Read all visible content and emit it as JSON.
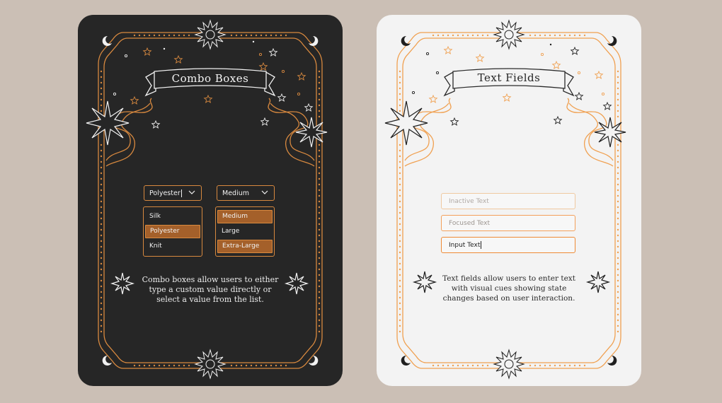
{
  "combo_card": {
    "title": "Combo Boxes",
    "fabric_combo": {
      "value": "Polyester"
    },
    "size_combo": {
      "value": "Medium"
    },
    "fabric_options": [
      "Silk",
      "Polyester",
      "Knit"
    ],
    "fabric_selected_index": 1,
    "size_options": [
      "Medium",
      "Large",
      "Extra-Large"
    ],
    "size_selected_indices": [
      0,
      2
    ],
    "description_lines": [
      "Combo boxes allow users to either",
      "type a custom value directly or",
      "select a value from the list."
    ]
  },
  "textfield_card": {
    "title": "Text Fields",
    "inactive_field": "Inactive Text",
    "focused_field": "Focused Text",
    "input_field": "Input Text",
    "description_lines": [
      "Text fields allow users to enter text",
      "with visual cues showing state",
      "changes based on user interaction."
    ]
  },
  "colors": {
    "accent_orange": "#d8893f",
    "light_accent_orange": "#f4a05a",
    "selected_fill": "#a4602a",
    "dark_card": "#262626",
    "light_card": "#f3f3f3",
    "background": "#cbbfb5"
  },
  "icons": [
    "sun-icon",
    "crescent-moon-icon",
    "sparkle-star-icon",
    "small-star-icon",
    "chevron-down-icon"
  ]
}
